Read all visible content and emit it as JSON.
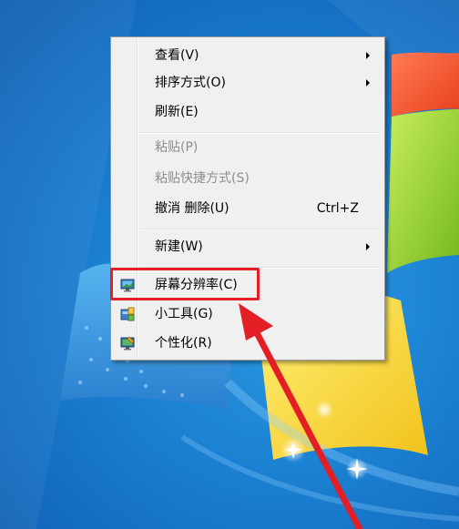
{
  "context_menu": {
    "items": [
      {
        "label": "查看(V)",
        "has_submenu": true,
        "enabled": true
      },
      {
        "label": "排序方式(O)",
        "has_submenu": true,
        "enabled": true
      },
      {
        "label": "刷新(E)",
        "enabled": true
      },
      {
        "label": "粘贴(P)",
        "enabled": false
      },
      {
        "label": "粘贴快捷方式(S)",
        "enabled": false
      },
      {
        "label": "撤消 删除(U)",
        "shortcut": "Ctrl+Z",
        "enabled": true
      },
      {
        "label": "新建(W)",
        "has_submenu": true,
        "enabled": true
      },
      {
        "label": "屏幕分辨率(C)",
        "icon": "screen-resolution-icon",
        "enabled": true,
        "highlighted": true
      },
      {
        "label": "小工具(G)",
        "icon": "gadgets-icon",
        "enabled": true
      },
      {
        "label": "个性化(R)",
        "icon": "personalize-icon",
        "enabled": true
      }
    ]
  },
  "annotation": {
    "highlight_color": "#e31e24",
    "arrow_color": "#e31e24",
    "target": "屏幕分辨率(C)"
  },
  "colors": {
    "desktop_blue": "#1e86d6",
    "menu_bg": "#f0f0f0",
    "disabled_text": "#8d8d8d"
  }
}
